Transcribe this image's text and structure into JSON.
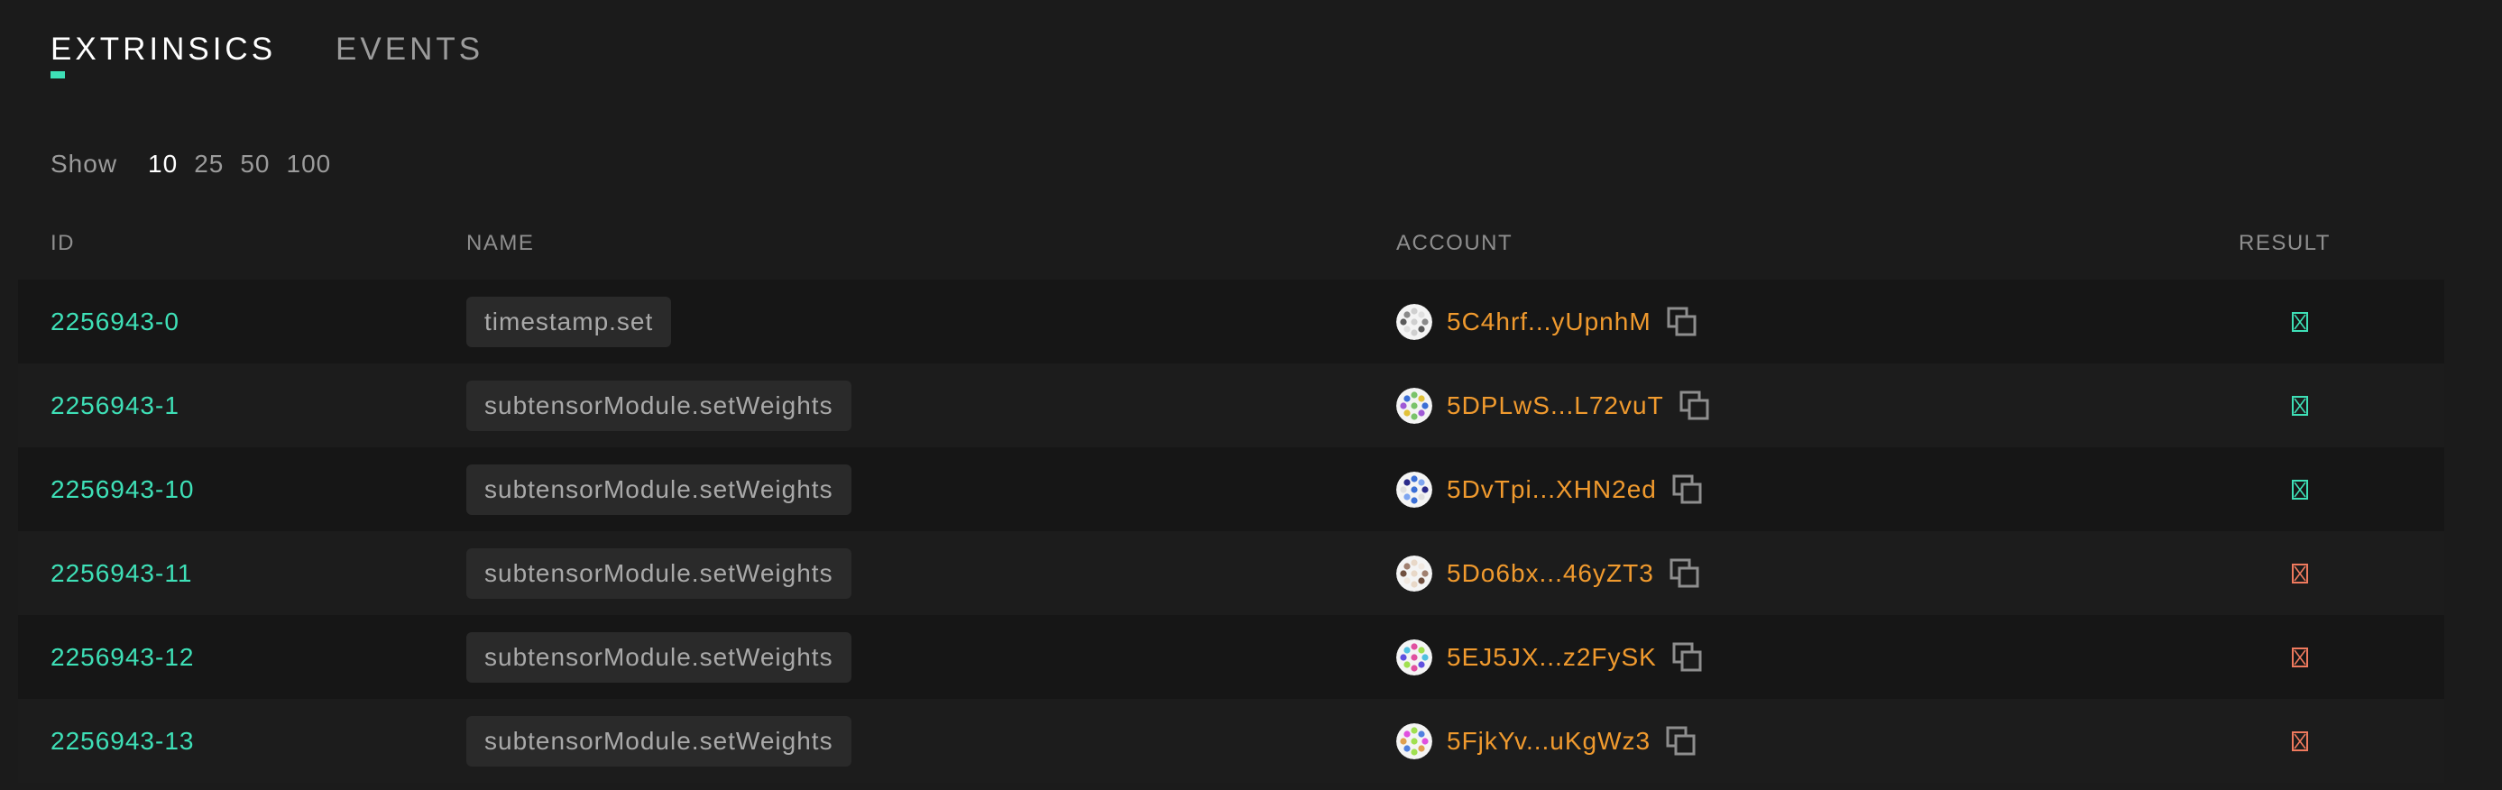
{
  "tabs": [
    {
      "label": "EXTRINSICS",
      "active": true
    },
    {
      "label": "EVENTS",
      "active": false
    }
  ],
  "show": {
    "label": "Show",
    "options": [
      "10",
      "25",
      "50",
      "100"
    ],
    "selected": "10"
  },
  "columns": {
    "id": "ID",
    "name": "NAME",
    "account": "ACCOUNT",
    "result": "RESULT"
  },
  "colors": {
    "accent": "#3ee0b7",
    "address": "#f09a2e",
    "success": "#3ee0b7",
    "failure": "#f07a5e"
  },
  "rows": [
    {
      "id": "2256943-0",
      "name": "timestamp.set",
      "account": "5C4hrf...yUpnhM",
      "result": "success"
    },
    {
      "id": "2256943-1",
      "name": "subtensorModule.setWeights",
      "account": "5DPLwS...L72vuT",
      "result": "success"
    },
    {
      "id": "2256943-10",
      "name": "subtensorModule.setWeights",
      "account": "5DvTpi...XHN2ed",
      "result": "success"
    },
    {
      "id": "2256943-11",
      "name": "subtensorModule.setWeights",
      "account": "5Do6bx...46yZT3",
      "result": "failure"
    },
    {
      "id": "2256943-12",
      "name": "subtensorModule.setWeights",
      "account": "5EJ5JX...z2FySK",
      "result": "failure"
    },
    {
      "id": "2256943-13",
      "name": "subtensorModule.setWeights",
      "account": "5FjkYv...uKgWz3",
      "result": "failure"
    }
  ]
}
